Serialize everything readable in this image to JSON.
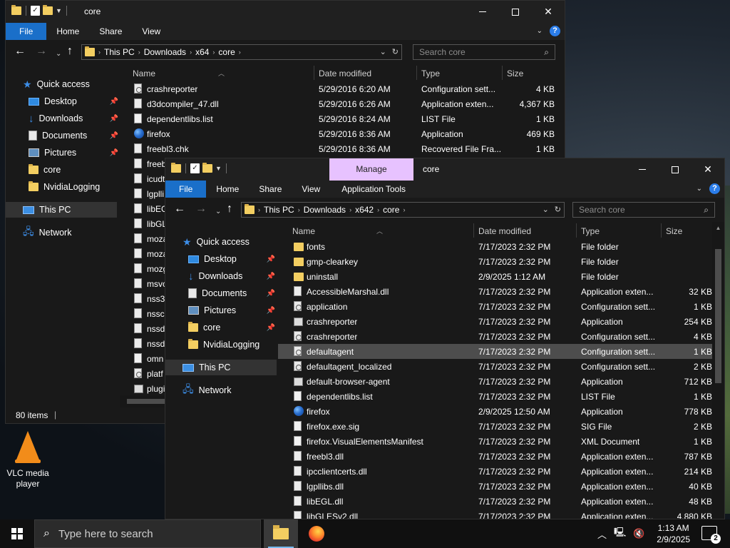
{
  "desktop": {
    "icons": [
      {
        "label": "VLC media player"
      }
    ]
  },
  "back_window": {
    "title": "core",
    "ribbon_tabs": [
      "File",
      "Home",
      "Share",
      "View"
    ],
    "breadcrumb": [
      "This PC",
      "Downloads",
      "x64",
      "core"
    ],
    "search_placeholder": "Search core",
    "nav": {
      "quick_access": "Quick access",
      "items": [
        "Desktop",
        "Downloads",
        "Documents",
        "Pictures",
        "core",
        "NvidiaLogging"
      ],
      "this_pc": "This PC",
      "network": "Network"
    },
    "columns": [
      "Name",
      "Date modified",
      "Type",
      "Size"
    ],
    "rows": [
      {
        "name": "crashreporter",
        "date": "5/29/2016 6:20 AM",
        "type": "Configuration sett...",
        "size": "4 KB",
        "icon": "cfg"
      },
      {
        "name": "d3dcompiler_47.dll",
        "date": "5/29/2016 6:26 AM",
        "type": "Application exten...",
        "size": "4,367 KB",
        "icon": "dll"
      },
      {
        "name": "dependentlibs.list",
        "date": "5/29/2016 8:24 AM",
        "type": "LIST File",
        "size": "1 KB",
        "icon": "file"
      },
      {
        "name": "firefox",
        "date": "5/29/2016 8:36 AM",
        "type": "Application",
        "size": "469 KB",
        "icon": "ff"
      },
      {
        "name": "freebl3.chk",
        "date": "5/29/2016 8:36 AM",
        "type": "Recovered File Fra...",
        "size": "1 KB",
        "icon": "dll"
      },
      {
        "name": "freeb",
        "icon": "dll"
      },
      {
        "name": "icudt",
        "icon": "dll"
      },
      {
        "name": "lgplli",
        "icon": "dll"
      },
      {
        "name": "libEG",
        "icon": "dll"
      },
      {
        "name": "libGL",
        "icon": "dll"
      },
      {
        "name": "moza",
        "icon": "dll"
      },
      {
        "name": "moza",
        "icon": "dll"
      },
      {
        "name": "mozg",
        "icon": "dll"
      },
      {
        "name": "msvc",
        "icon": "dll"
      },
      {
        "name": "nss3.",
        "icon": "dll"
      },
      {
        "name": "nsscl",
        "icon": "dll"
      },
      {
        "name": "nssdl",
        "icon": "dll"
      },
      {
        "name": "nssdl",
        "icon": "dll"
      },
      {
        "name": "omn",
        "icon": "file"
      },
      {
        "name": "platf",
        "icon": "cfg"
      },
      {
        "name": "plugi",
        "icon": "app"
      }
    ],
    "status": "80 items"
  },
  "front_window": {
    "title": "core",
    "manage_label": "Manage",
    "ribbon_tabs": [
      "File",
      "Home",
      "Share",
      "View",
      "Application Tools"
    ],
    "breadcrumb": [
      "This PC",
      "Downloads",
      "x642",
      "core"
    ],
    "search_placeholder": "Search core",
    "nav": {
      "quick_access": "Quick access",
      "items": [
        "Desktop",
        "Downloads",
        "Documents",
        "Pictures",
        "core",
        "NvidiaLogging"
      ],
      "this_pc": "This PC",
      "network": "Network"
    },
    "columns": [
      "Name",
      "Date modified",
      "Type",
      "Size"
    ],
    "selected_row": 7,
    "rows": [
      {
        "name": "fonts",
        "date": "7/17/2023 2:32 PM",
        "type": "File folder",
        "size": "",
        "icon": "folder"
      },
      {
        "name": "gmp-clearkey",
        "date": "7/17/2023 2:32 PM",
        "type": "File folder",
        "size": "",
        "icon": "folder"
      },
      {
        "name": "uninstall",
        "date": "2/9/2025 1:12 AM",
        "type": "File folder",
        "size": "",
        "icon": "folder"
      },
      {
        "name": "AccessibleMarshal.dll",
        "date": "7/17/2023 2:32 PM",
        "type": "Application exten...",
        "size": "32 KB",
        "icon": "dll"
      },
      {
        "name": "application",
        "date": "7/17/2023 2:32 PM",
        "type": "Configuration sett...",
        "size": "1 KB",
        "icon": "cfg"
      },
      {
        "name": "crashreporter",
        "date": "7/17/2023 2:32 PM",
        "type": "Application",
        "size": "254 KB",
        "icon": "app"
      },
      {
        "name": "crashreporter",
        "date": "7/17/2023 2:32 PM",
        "type": "Configuration sett...",
        "size": "4 KB",
        "icon": "cfg"
      },
      {
        "name": "defaultagent",
        "date": "7/17/2023 2:32 PM",
        "type": "Configuration sett...",
        "size": "1 KB",
        "icon": "cfg"
      },
      {
        "name": "defaultagent_localized",
        "date": "7/17/2023 2:32 PM",
        "type": "Configuration sett...",
        "size": "2 KB",
        "icon": "cfg"
      },
      {
        "name": "default-browser-agent",
        "date": "7/17/2023 2:32 PM",
        "type": "Application",
        "size": "712 KB",
        "icon": "app"
      },
      {
        "name": "dependentlibs.list",
        "date": "7/17/2023 2:32 PM",
        "type": "LIST File",
        "size": "1 KB",
        "icon": "file"
      },
      {
        "name": "firefox",
        "date": "2/9/2025 12:50 AM",
        "type": "Application",
        "size": "778 KB",
        "icon": "ff"
      },
      {
        "name": "firefox.exe.sig",
        "date": "7/17/2023 2:32 PM",
        "type": "SIG File",
        "size": "2 KB",
        "icon": "file"
      },
      {
        "name": "firefox.VisualElementsManifest",
        "date": "7/17/2023 2:32 PM",
        "type": "XML Document",
        "size": "1 KB",
        "icon": "file"
      },
      {
        "name": "freebl3.dll",
        "date": "7/17/2023 2:32 PM",
        "type": "Application exten...",
        "size": "787 KB",
        "icon": "dll"
      },
      {
        "name": "ipcclientcerts.dll",
        "date": "7/17/2023 2:32 PM",
        "type": "Application exten...",
        "size": "214 KB",
        "icon": "dll"
      },
      {
        "name": "lgpllibs.dll",
        "date": "7/17/2023 2:32 PM",
        "type": "Application exten...",
        "size": "40 KB",
        "icon": "dll"
      },
      {
        "name": "libEGL.dll",
        "date": "7/17/2023 2:32 PM",
        "type": "Application exten...",
        "size": "48 KB",
        "icon": "dll"
      },
      {
        "name": "libGLESv2.dll",
        "date": "7/17/2023 2:32 PM",
        "type": "Application exten...",
        "size": "4,880 KB",
        "icon": "dll"
      }
    ]
  },
  "taskbar": {
    "search_placeholder": "Type here to search",
    "time": "1:13 AM",
    "date": "2/9/2025",
    "notification_count": "2"
  }
}
